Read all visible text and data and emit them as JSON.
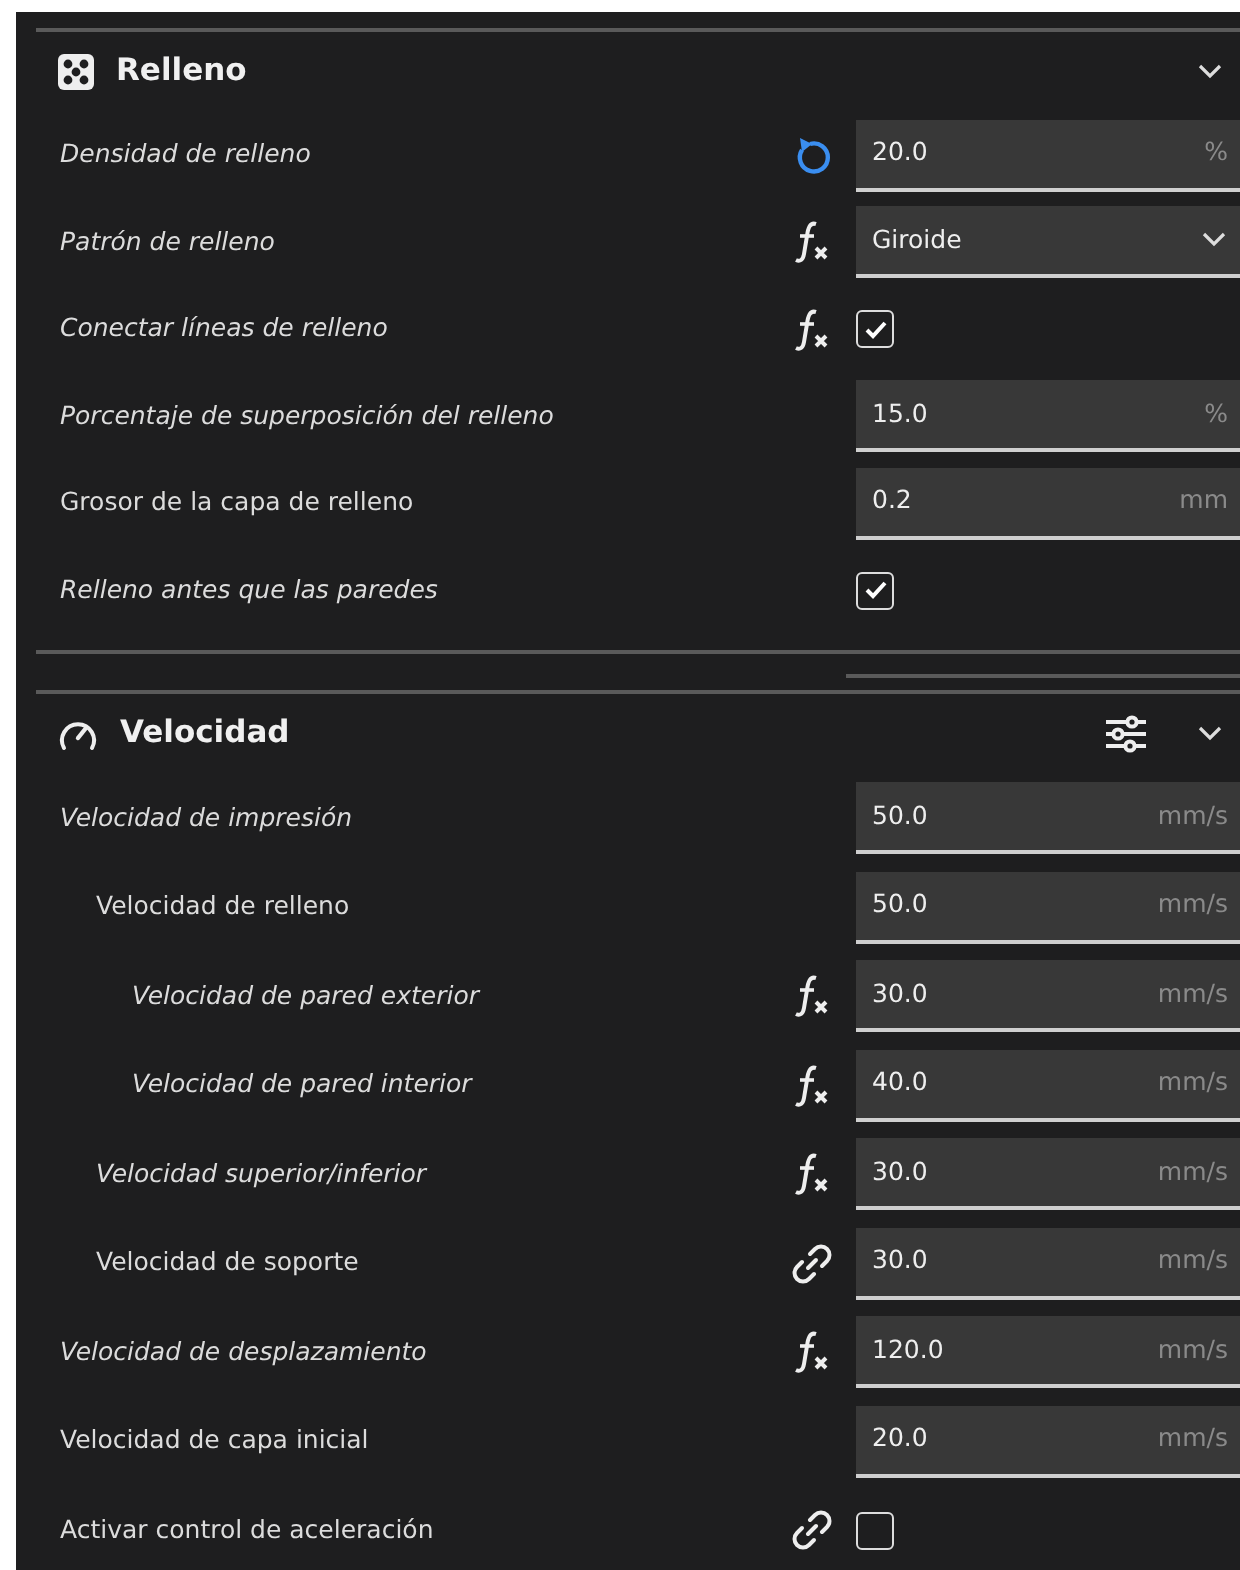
{
  "sections": [
    {
      "title": "Relleno",
      "has_settings_button": false,
      "expanded": true,
      "settings": [
        {
          "label": "Densidad de relleno",
          "modified": true,
          "indicator": {
            "kind": "reset"
          },
          "kind": "field",
          "value": "20.0",
          "unit": "%"
        },
        {
          "label": "Patrón de relleno",
          "modified": true,
          "indicator": {
            "kind": "formula"
          },
          "kind": "dropdown",
          "value": "Giroide"
        },
        {
          "label": "Conectar líneas de relleno",
          "modified": true,
          "indicator": {
            "kind": "formula"
          },
          "kind": "checkbox",
          "checked": true
        },
        {
          "label": "Porcentaje de superposición del relleno",
          "modified": true,
          "kind": "field",
          "value": "15.0",
          "unit": "%"
        },
        {
          "label": "Grosor de la capa de relleno",
          "modified": false,
          "kind": "field",
          "value": "0.2",
          "unit": "mm"
        },
        {
          "label": "Relleno antes que las paredes",
          "modified": true,
          "kind": "checkbox",
          "checked": true
        }
      ]
    },
    {
      "title": "Velocidad",
      "has_settings_button": true,
      "expanded": true,
      "settings": [
        {
          "label": "Velocidad de impresión",
          "modified": true,
          "kind": "field",
          "value": "50.0",
          "unit": "mm/s",
          "children": [
            {
              "label": "Velocidad de relleno",
              "modified": false,
              "kind": "field",
              "value": "50.0",
              "unit": "mm/s",
              "children": [
                {
                  "label": "Velocidad de pared exterior",
                  "modified": true,
                  "indicator": {
                    "kind": "formula"
                  },
                  "kind": "field",
                  "value": "30.0",
                  "unit": "mm/s"
                },
                {
                  "label": "Velocidad de pared interior",
                  "modified": true,
                  "indicator": {
                    "kind": "formula"
                  },
                  "kind": "field",
                  "value": "40.0",
                  "unit": "mm/s"
                }
              ]
            },
            {
              "label": "Velocidad superior/inferior",
              "modified": true,
              "indicator": {
                "kind": "formula"
              },
              "kind": "field",
              "value": "30.0",
              "unit": "mm/s"
            },
            {
              "label": "Velocidad de soporte",
              "modified": false,
              "indicator": {
                "kind": "linked"
              },
              "kind": "field",
              "value": "30.0",
              "unit": "mm/s"
            }
          ]
        },
        {
          "label": "Velocidad de desplazamiento",
          "modified": true,
          "indicator": {
            "kind": "formula"
          },
          "kind": "field",
          "value": "120.0",
          "unit": "mm/s"
        },
        {
          "label": "Velocidad de capa inicial",
          "modified": false,
          "kind": "field",
          "value": "20.0",
          "unit": "mm/s"
        },
        {
          "label": "Activar control de aceleración",
          "modified": false,
          "indicator": {
            "kind": "linked"
          },
          "kind": "checkbox",
          "checked": false
        }
      ]
    }
  ]
}
